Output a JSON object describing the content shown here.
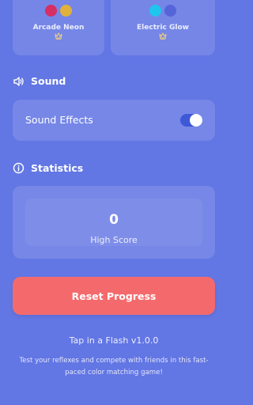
{
  "themes": [
    {
      "name": "Arcade Neon",
      "colors": [
        "#d62f63",
        "#e0b23c"
      ],
      "crown_icon": "crown-icon"
    },
    {
      "name": "Electric Glow",
      "colors": [
        "#1ec6ee",
        "#5564d8"
      ],
      "crown_icon": "crown-icon"
    }
  ],
  "sound": {
    "title": "Sound",
    "icon": "speaker-icon",
    "sound_effects_label": "Sound Effects",
    "sound_effects_enabled": true
  },
  "statistics": {
    "title": "Statistics",
    "icon": "info-icon",
    "high_score_value": "0",
    "high_score_label": "High Score"
  },
  "reset_button_label": "Reset Progress",
  "footer": {
    "version": "Tap in a Flash v1.0.0",
    "description": "Test your reflexes and compete with friends in this fast-paced color matching game!"
  },
  "colors": {
    "background": "#6276e4",
    "reset_button": "#f46a6c",
    "toggle_track": "#3e58d6"
  }
}
